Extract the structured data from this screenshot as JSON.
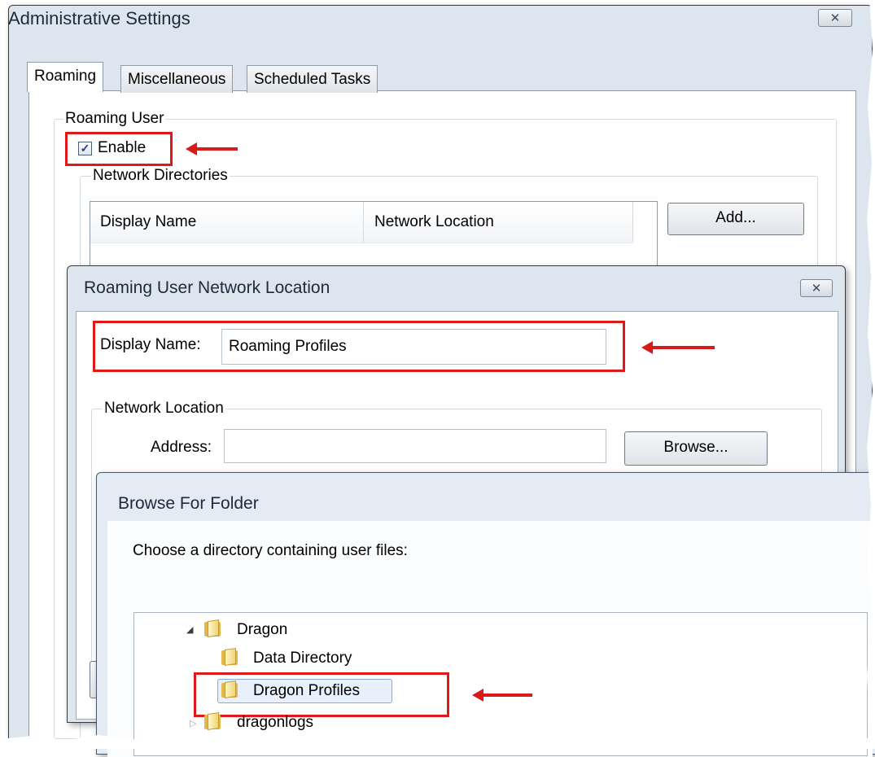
{
  "admin_window": {
    "title": "Administrative Settings",
    "close_glyph": "✕",
    "tabs": [
      {
        "label": "Roaming"
      },
      {
        "label": "Miscellaneous"
      },
      {
        "label": "Scheduled Tasks"
      }
    ],
    "roaming_group": {
      "label": "Roaming User",
      "enable_label": "Enable",
      "enable_checked": true,
      "check_glyph": "✓"
    },
    "network_dirs": {
      "label": "Network Directories",
      "columns": [
        "Display Name",
        "Network Location"
      ],
      "add_button": "Add..."
    }
  },
  "location_dialog": {
    "title": "Roaming User Network Location",
    "close_glyph": "✕",
    "display_name_label": "Display Name:",
    "display_name_value": "Roaming Profiles",
    "network_location_label": "Network Location",
    "address_label": "Address:",
    "address_value": "",
    "browse_button": "Browse..."
  },
  "browse_dialog": {
    "title": "Browse For Folder",
    "prompt": "Choose a directory containing user files:",
    "tree": {
      "expanded_glyph": "◢",
      "collapsed_glyph": "▷",
      "items": [
        {
          "label": "Dragon",
          "icon": "folder-icon"
        },
        {
          "label": "Data Directory",
          "icon": "folder-icon"
        },
        {
          "label": "Dragon Profiles",
          "icon": "folder-icon",
          "selected": true
        },
        {
          "label": "dragonlogs",
          "icon": "folder-icon"
        }
      ]
    }
  },
  "annotation_colors": {
    "highlight": "#e01818",
    "arrow": "#d81a1a"
  }
}
